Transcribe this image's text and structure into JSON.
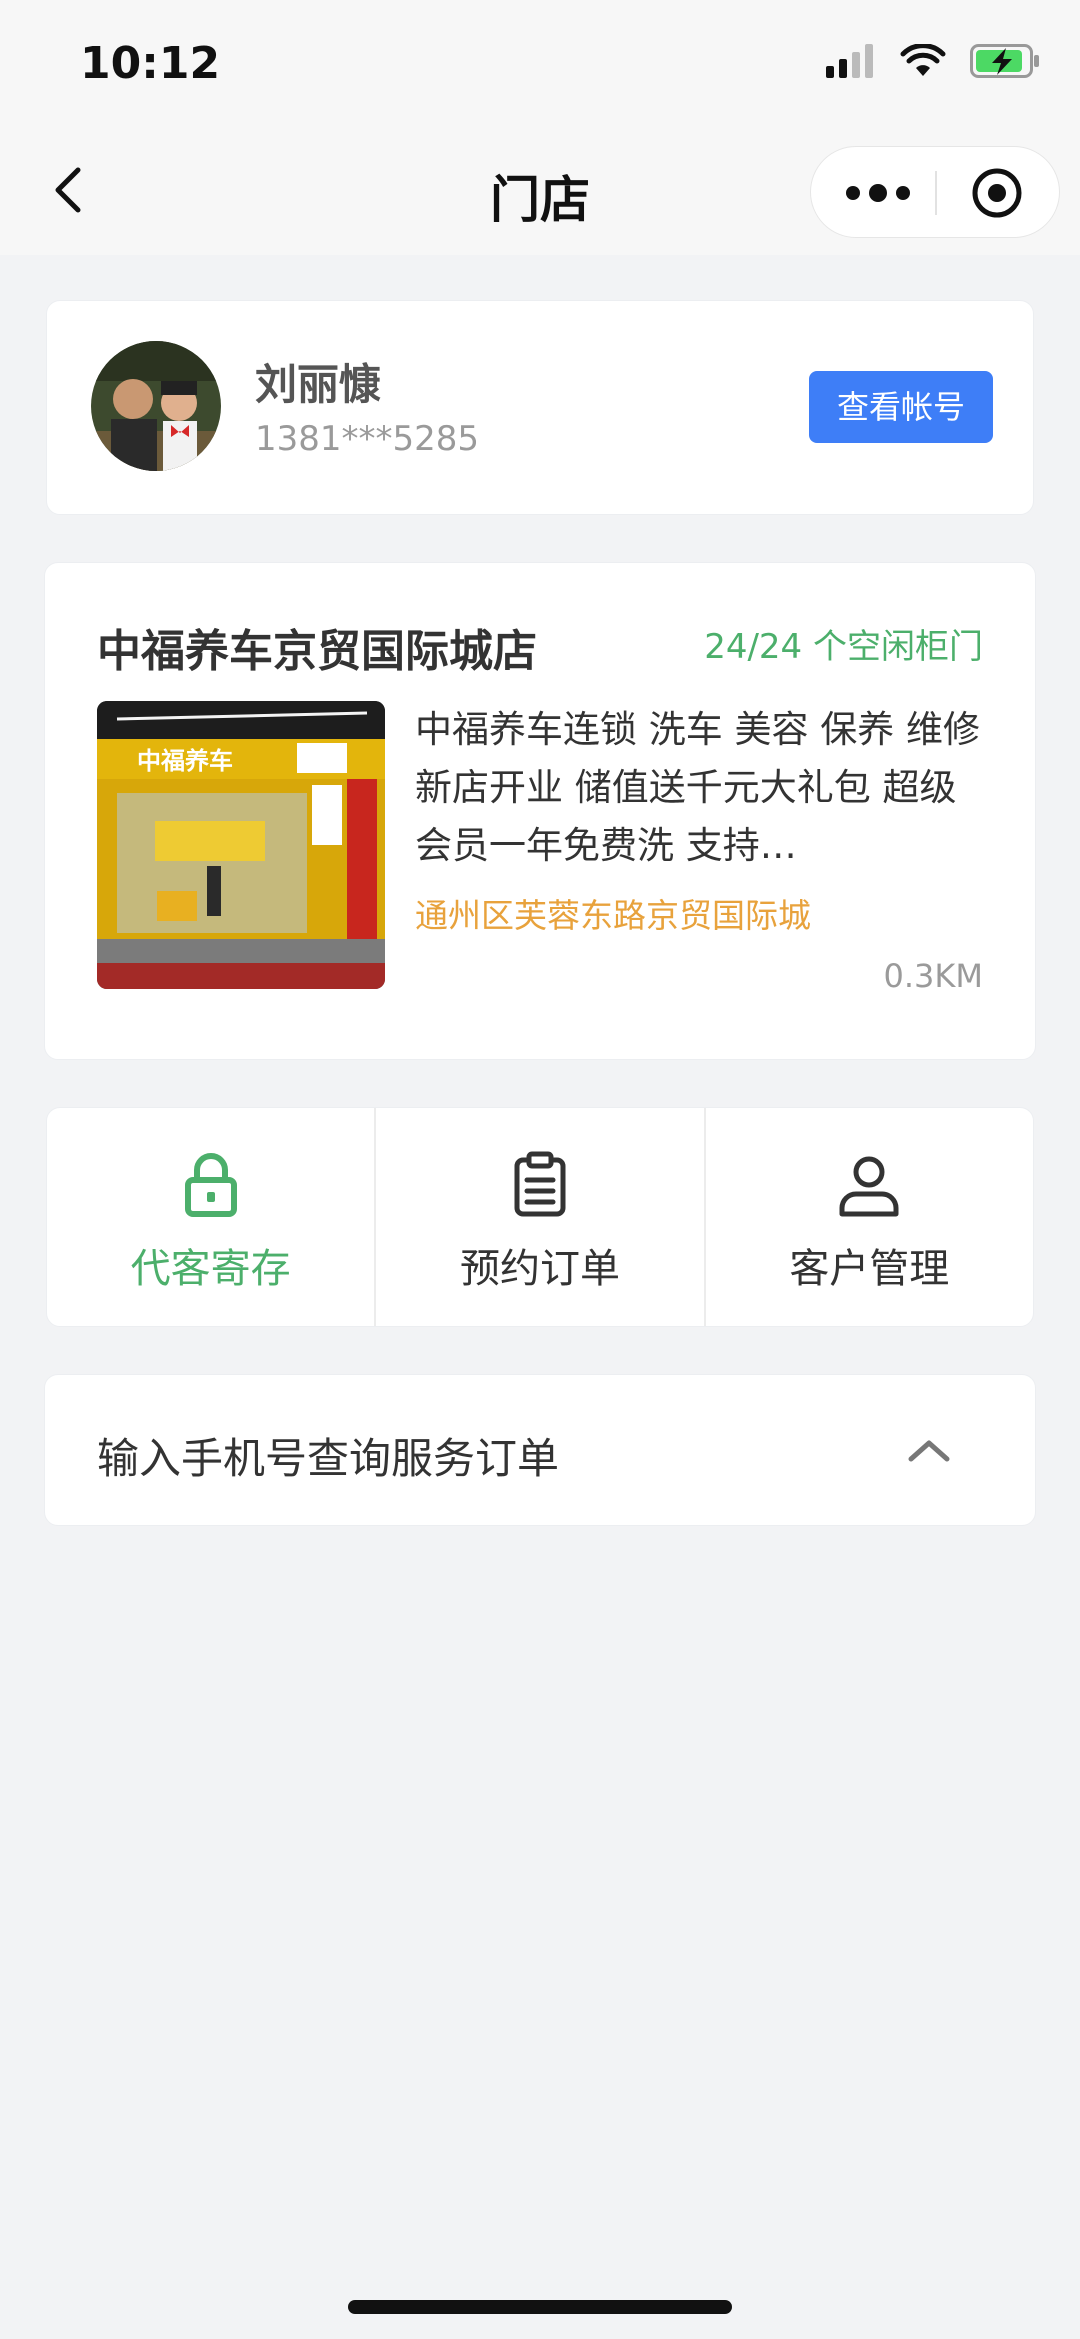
{
  "status_bar": {
    "time": "10:12"
  },
  "nav": {
    "title": "门店"
  },
  "user": {
    "name": "刘丽慷",
    "phone": "1381***5285",
    "view_account_label": "查看帐号"
  },
  "store": {
    "name": "中福养车京贸国际城店",
    "lockers": "24/24 个空闲柜门",
    "description": "中福养车连锁 洗车 美容 保养 维修 新店开业 储值送千元大礼包 超级会员一年免费洗 支持…",
    "address": "通州区芙蓉东路京贸国际城",
    "distance": "0.3KM",
    "photo": {
      "sign_text": "中福养车"
    }
  },
  "actions": [
    {
      "label": "代客寄存",
      "icon": "lock-icon",
      "active": true
    },
    {
      "label": "预约订单",
      "icon": "clipboard-icon",
      "active": false
    },
    {
      "label": "客户管理",
      "icon": "person-icon",
      "active": false
    }
  ],
  "query": {
    "label": "输入手机号查询服务订单"
  },
  "colors": {
    "accent_green": "#4caf6b",
    "button_blue": "#3e7ef7",
    "address_orange": "#e8a23c",
    "background": "#f2f3f5"
  }
}
